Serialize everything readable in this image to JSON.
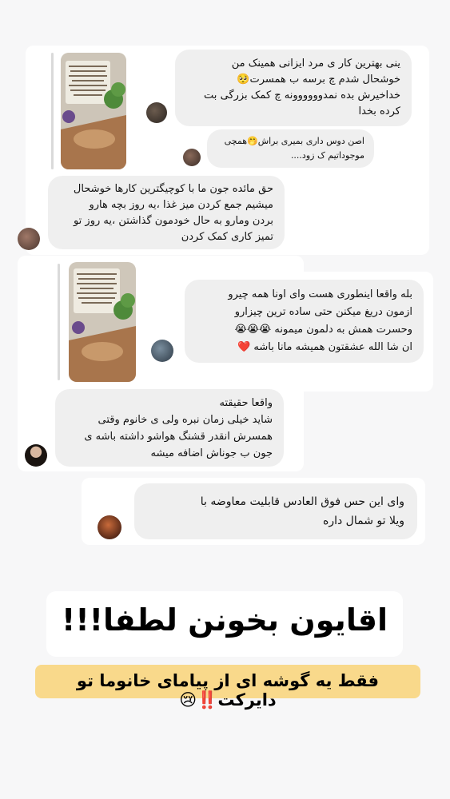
{
  "messages": [
    {
      "lines": [
        "ینی بهترین کار ی مرد ایزانی همینک من",
        "خوشحال شدم چ برسه ب همسرت🥺",
        "خداخیرش بده نمدوووووونه چ کمک بزرگی بت",
        "کرده بخدا"
      ]
    },
    {
      "lines": [
        "اصن دوس داری بمیری براش🤭همچی",
        "موجوداتیم ک زود...."
      ]
    },
    {
      "lines": [
        "حق مائده جون ما با کوچیگترین کارها خوشحال",
        "میشیم جمع کردن میز غذا ،یه روز بچه هارو",
        "بردن ومارو به حال خودمون گذاشتن ،یه روز تو",
        "تمیز کاری کمک کردن"
      ]
    },
    {
      "lines": [
        "بله واقعا اینطوری هست وای اونا همه چیرو",
        "ازمون دریغ میکنن حتی ساده ترین چیزارو",
        "وحسرت همش به دلمون میمونه 😭😭😭",
        "ان شا الله عشقتون همیشه مانا باشه ❤️"
      ]
    },
    {
      "lines": [
        "واقعا حقیقته",
        "شاید خیلی زمان نبره ولی ی خانوم وقتی",
        "همسرش انقدر قشنگ هواشو داشته باشه ی",
        "جون ب جوناش اضافه میشه"
      ]
    },
    {
      "lines": [
        "وای این حس فوق العادس قابلیت معاوضه با",
        "ویلا تو شمال داره"
      ]
    }
  ],
  "title": "اقایون بخونن لطفا!!!",
  "subtitle": "فقط یه گوشه ای از پیامای خانوما تو دایرکت‼️😢",
  "colors": {
    "bubble": "#efefef",
    "highlight": "#f9d98b",
    "background": "#f7f7f8"
  }
}
